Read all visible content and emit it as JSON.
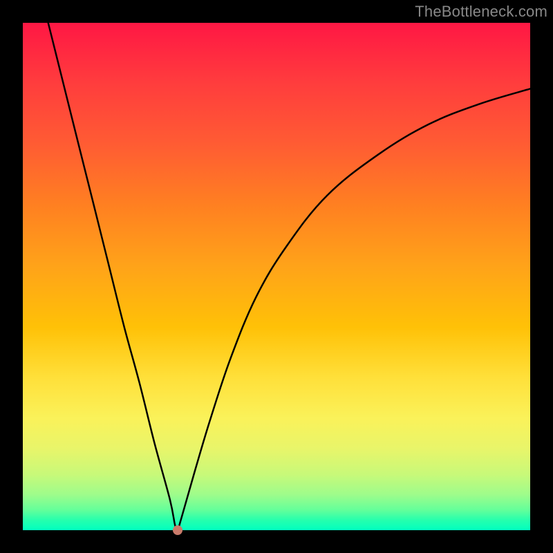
{
  "watermark": "TheBottleneck.com",
  "colors": {
    "page_bg": "#000000",
    "curve": "#000000",
    "dot": "#c97a6a"
  },
  "chart_data": {
    "type": "line",
    "title": "",
    "xlabel": "",
    "ylabel": "",
    "xlim": [
      0,
      100
    ],
    "ylim": [
      0,
      100
    ],
    "grid": false,
    "legend": false,
    "series": [
      {
        "name": "bottleneck-curve",
        "x": [
          5,
          8,
          11,
          14,
          17,
          20,
          23,
          26,
          29,
          30,
          30.5,
          31,
          32,
          34,
          37,
          41,
          46,
          52,
          60,
          70,
          80,
          90,
          100
        ],
        "y": [
          100,
          88,
          76,
          64,
          52,
          40,
          29,
          17,
          6,
          1,
          0,
          1.5,
          5,
          12,
          22,
          34,
          46,
          56,
          66,
          74,
          80,
          84,
          87
        ]
      }
    ],
    "annotations": [
      {
        "type": "point",
        "name": "minimum-marker",
        "x": 30.5,
        "y": 0
      }
    ]
  }
}
